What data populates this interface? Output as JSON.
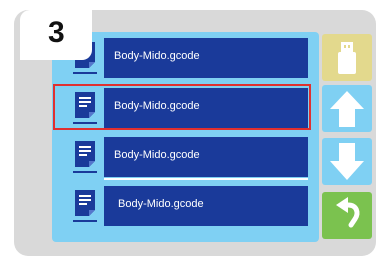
{
  "step_number": "3",
  "files": [
    {
      "name": "Body-Mido.gcode"
    },
    {
      "name": "Body-Mido.gcode"
    },
    {
      "name": "Body-Mido.gcode"
    },
    {
      "name": "Body-Mido.gcode"
    }
  ],
  "selected_index": 1,
  "colors": {
    "panel": "#d9d9d9",
    "list_bg": "#7fd0f3",
    "file_bar": "#1a3a9a",
    "highlight": "#e03030",
    "usb_button": "#e3d98d",
    "arrow_button": "#7fd0f3",
    "back_button": "#7bc24f"
  },
  "buttons": {
    "usb": {
      "icon": "usb-drive-icon"
    },
    "up": {
      "icon": "arrow-up-icon"
    },
    "down": {
      "icon": "arrow-down-icon"
    },
    "back": {
      "icon": "back-arrow-icon"
    }
  }
}
